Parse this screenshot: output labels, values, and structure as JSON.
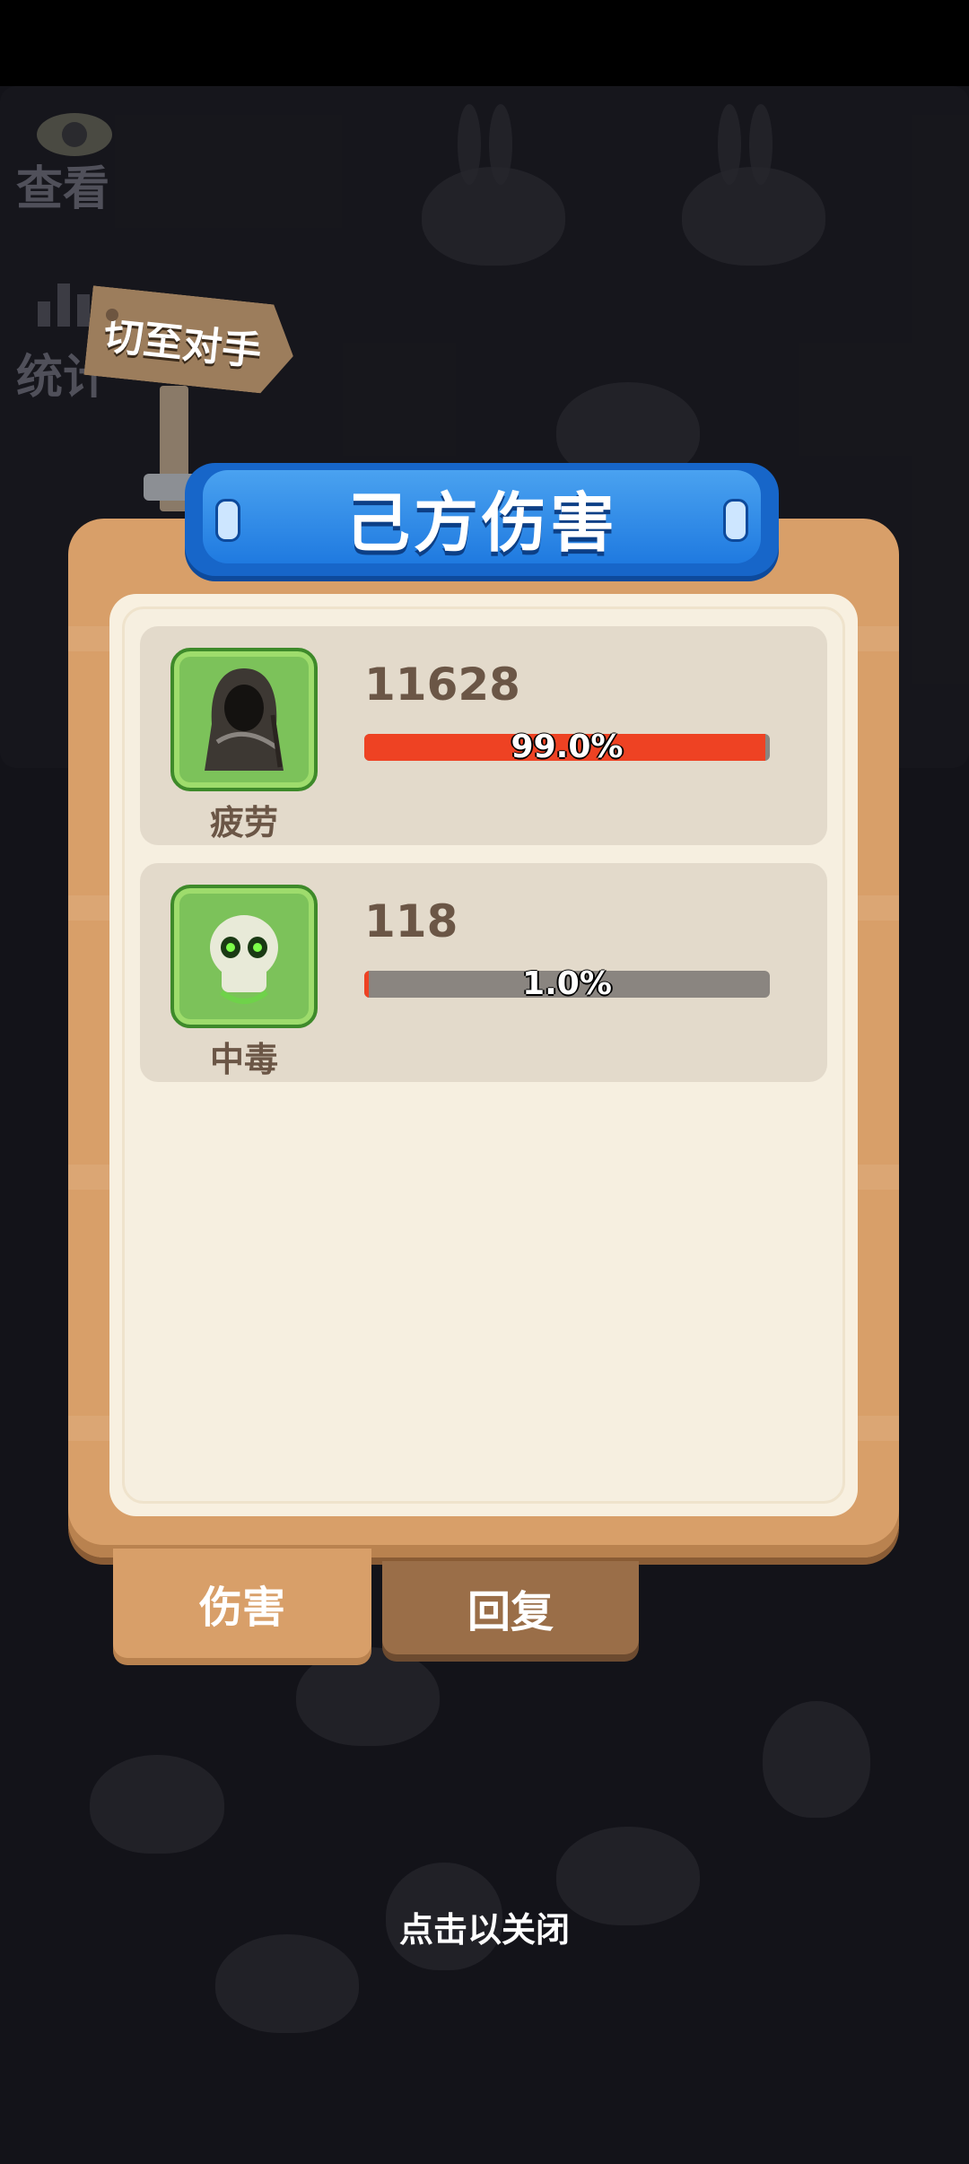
{
  "side_buttons": {
    "view": "查看",
    "stats": "统计"
  },
  "signpost": {
    "label": "切至对手"
  },
  "panel": {
    "title": "己方伤害"
  },
  "rows": [
    {
      "name": "疲劳",
      "value": "11628",
      "percent_text": "99.0%",
      "percent": 0.99,
      "icon": "hooded-reaper-icon"
    },
    {
      "name": "中毒",
      "value": "118",
      "percent_text": "1.0%",
      "percent": 0.01,
      "icon": "green-skull-icon"
    }
  ],
  "tabs": {
    "damage": "伤害",
    "heal": "回复",
    "active": "damage"
  },
  "close_hint": "点击以关闭",
  "colors": {
    "bar_fill": "#ee4223",
    "bar_bg": "#8a8580",
    "banner": "#1f7ae0",
    "panel": "#d89f69"
  }
}
